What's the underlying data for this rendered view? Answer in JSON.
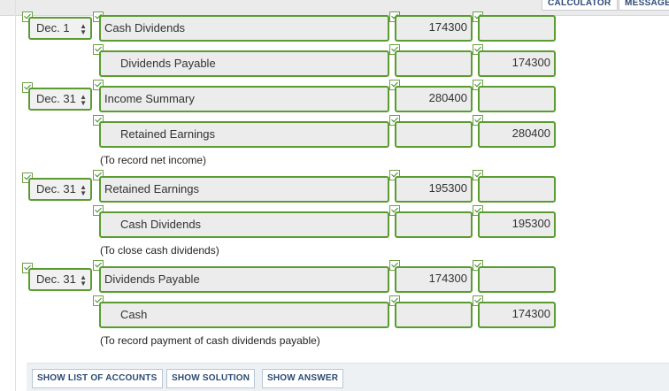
{
  "toolbar": {
    "calculator": "CALCULATOR",
    "message": "MESSAGE"
  },
  "rows": [
    {
      "date": "Dec. 1",
      "account": "Cash Dividends",
      "debit": "174300",
      "credit": ""
    },
    {
      "date": "",
      "account": "Dividends Payable",
      "debit": "",
      "credit": "174300"
    },
    {
      "date": "Dec. 31",
      "account": "Income Summary",
      "debit": "280400",
      "credit": ""
    },
    {
      "date": "",
      "account": "Retained Earnings",
      "debit": "",
      "credit": "280400"
    },
    {
      "date": "Dec. 31",
      "account": "Retained Earnings",
      "debit": "195300",
      "credit": ""
    },
    {
      "date": "",
      "account": "Cash Dividends",
      "debit": "",
      "credit": "195300"
    },
    {
      "date": "Dec. 31",
      "account": "Dividends Payable",
      "debit": "174300",
      "credit": ""
    },
    {
      "date": "",
      "account": "Cash",
      "debit": "",
      "credit": "174300"
    }
  ],
  "memos": [
    "(To record net income)",
    "(To close cash dividends)",
    "(To record payment of cash dividends payable)"
  ],
  "buttons": {
    "show_list": "SHOW LIST OF ACCOUNTS",
    "show_solution": "SHOW SOLUTION",
    "show_answer": "SHOW ANSWER"
  }
}
